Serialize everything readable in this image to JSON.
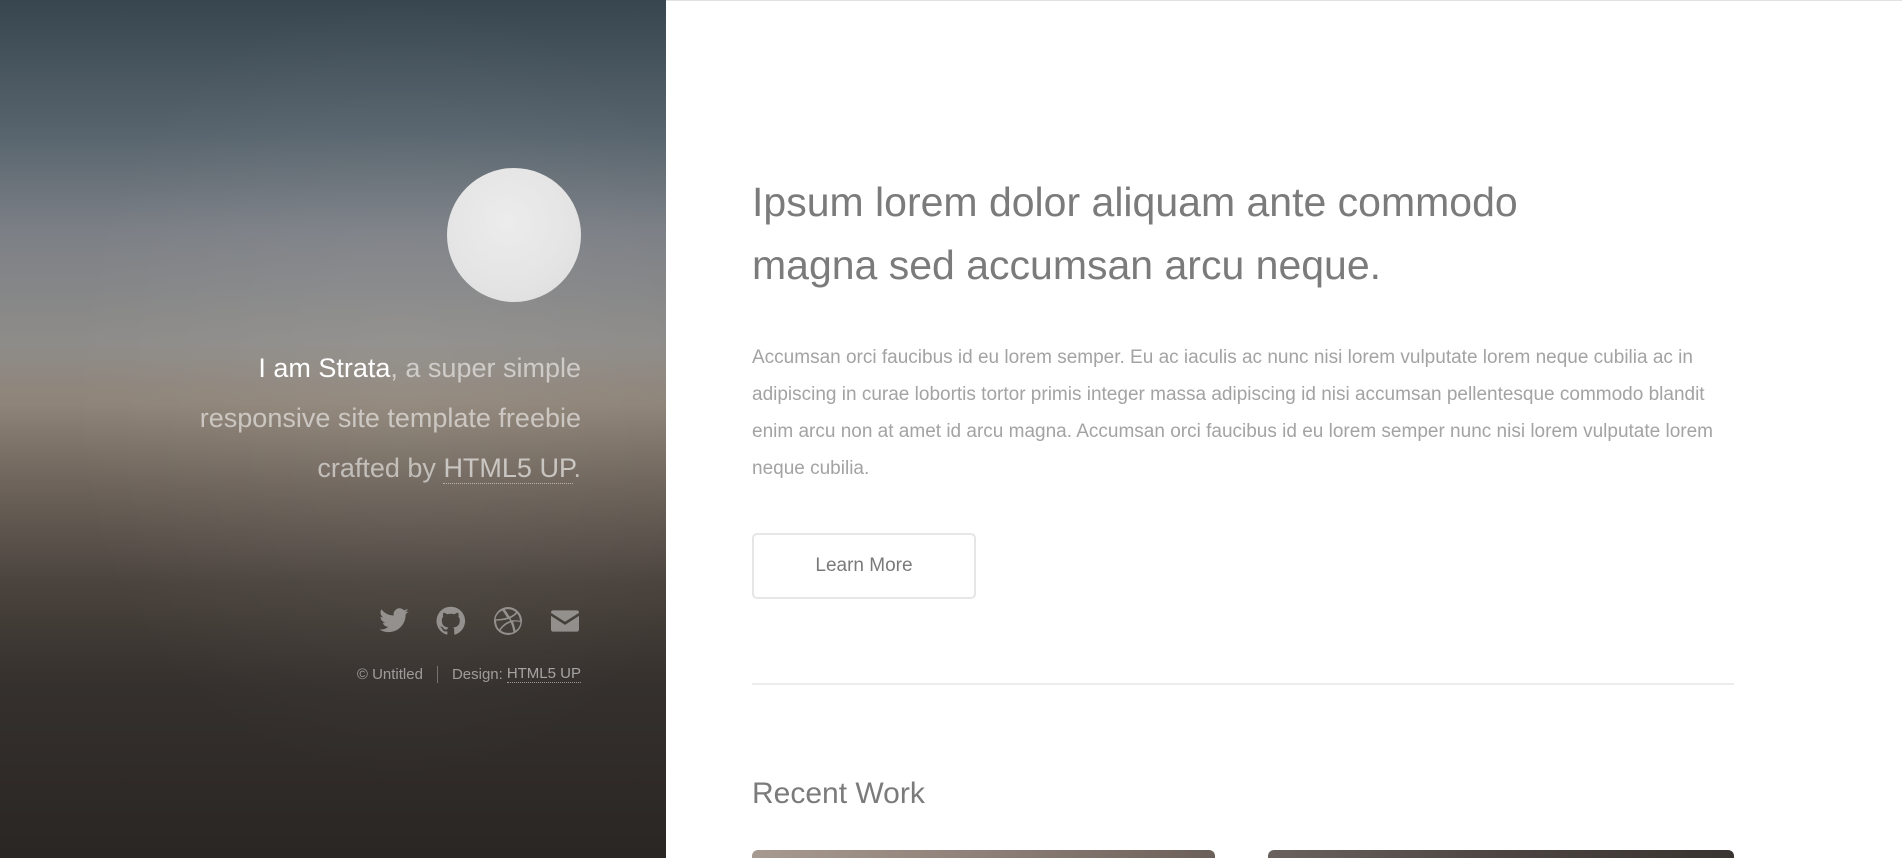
{
  "sidebar": {
    "intro_strong": "I am Strata",
    "intro_rest": ", a super simple responsive site template freebie crafted by ",
    "intro_link": "HTML5 UP",
    "intro_end": ".",
    "social": [
      {
        "icon": "twitter-icon"
      },
      {
        "icon": "github-icon"
      },
      {
        "icon": "dribbble-icon"
      },
      {
        "icon": "envelope-icon"
      }
    ],
    "copyright": "© Untitled",
    "design_label": "Design:",
    "design_link": "HTML5 UP"
  },
  "main": {
    "headline": "Ipsum lorem dolor aliquam ante commodo magna sed accumsan arcu neque.",
    "body": "Accumsan orci faucibus id eu lorem semper. Eu ac iaculis ac nunc nisi lorem vulputate lorem neque cubilia ac in adipiscing in curae lobortis tortor primis integer massa adipiscing id nisi accumsan pellentesque commodo blandit enim arcu non at amet id arcu magna. Accumsan orci faucibus id eu lorem semper nunc nisi lorem vulputate lorem neque cubilia.",
    "learn_more": "Learn More",
    "recent_work_title": "Recent Work"
  }
}
